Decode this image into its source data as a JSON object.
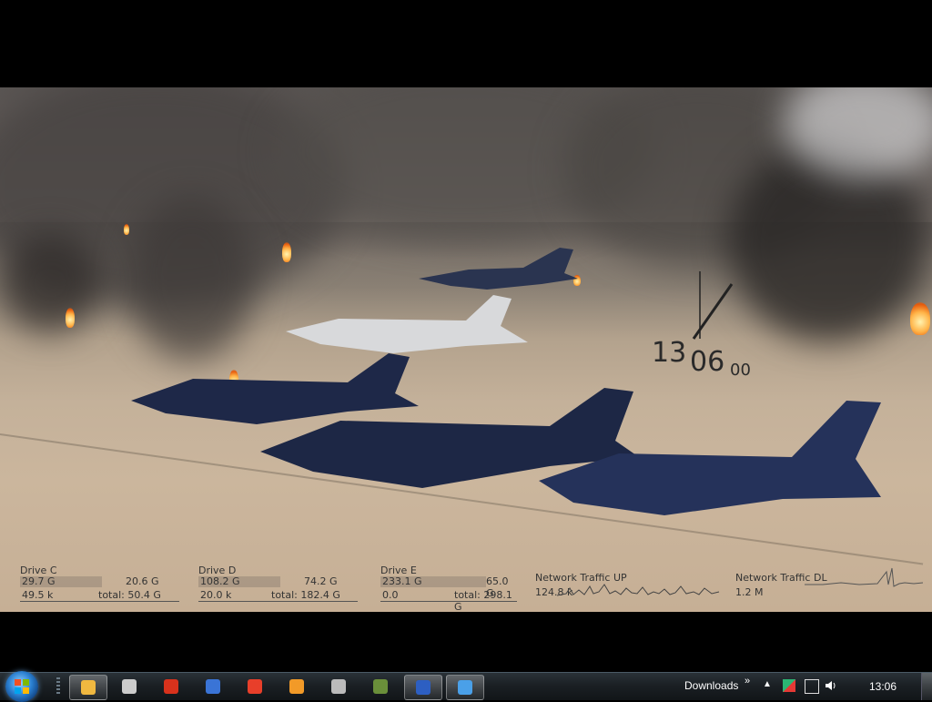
{
  "clock": {
    "hours": "13",
    "minutes": "06",
    "seconds": "00"
  },
  "drives": [
    {
      "name": "Drive C",
      "used": "29.7 G",
      "free": "20.6 G",
      "io": "49.5 k",
      "total": "total: 50.4 G"
    },
    {
      "name": "Drive D",
      "used": "108.2 G",
      "free": "74.2 G",
      "io": "20.0 k",
      "total": "total: 182.4 G"
    },
    {
      "name": "Drive E",
      "used": "233.1 G",
      "free": "65.0 G",
      "io": "0.0",
      "total": "total: 298.1 G"
    }
  ],
  "network": {
    "up": {
      "label": "Network Traffic UP",
      "value": "124.8 k"
    },
    "down": {
      "label": "Network Traffic DL",
      "value": "1.2 M"
    }
  },
  "taskbar": {
    "buttons": [
      {
        "name": "messenger",
        "color": "#f0b840",
        "active": true
      },
      {
        "name": "alien",
        "color": "#cccccc",
        "active": false
      },
      {
        "name": "opera",
        "color": "#d8321c",
        "active": false
      },
      {
        "name": "firefox",
        "color": "#3a74d6",
        "active": false
      },
      {
        "name": "grid-app",
        "color": "#e83f2a",
        "active": false
      },
      {
        "name": "paw",
        "color": "#f29a28",
        "active": false
      },
      {
        "name": "utorrent",
        "color": "#bbbbbb",
        "active": false
      },
      {
        "name": "miranda",
        "color": "#6a8f3a",
        "active": false
      },
      {
        "name": "save-app",
        "color": "#2d5fc2",
        "active": true
      },
      {
        "name": "globe",
        "color": "#4aa0e8",
        "active": true
      }
    ],
    "tray": {
      "toolbar_label": "Downloads",
      "toolbar_chevron": "»",
      "clock": "13:06"
    }
  }
}
